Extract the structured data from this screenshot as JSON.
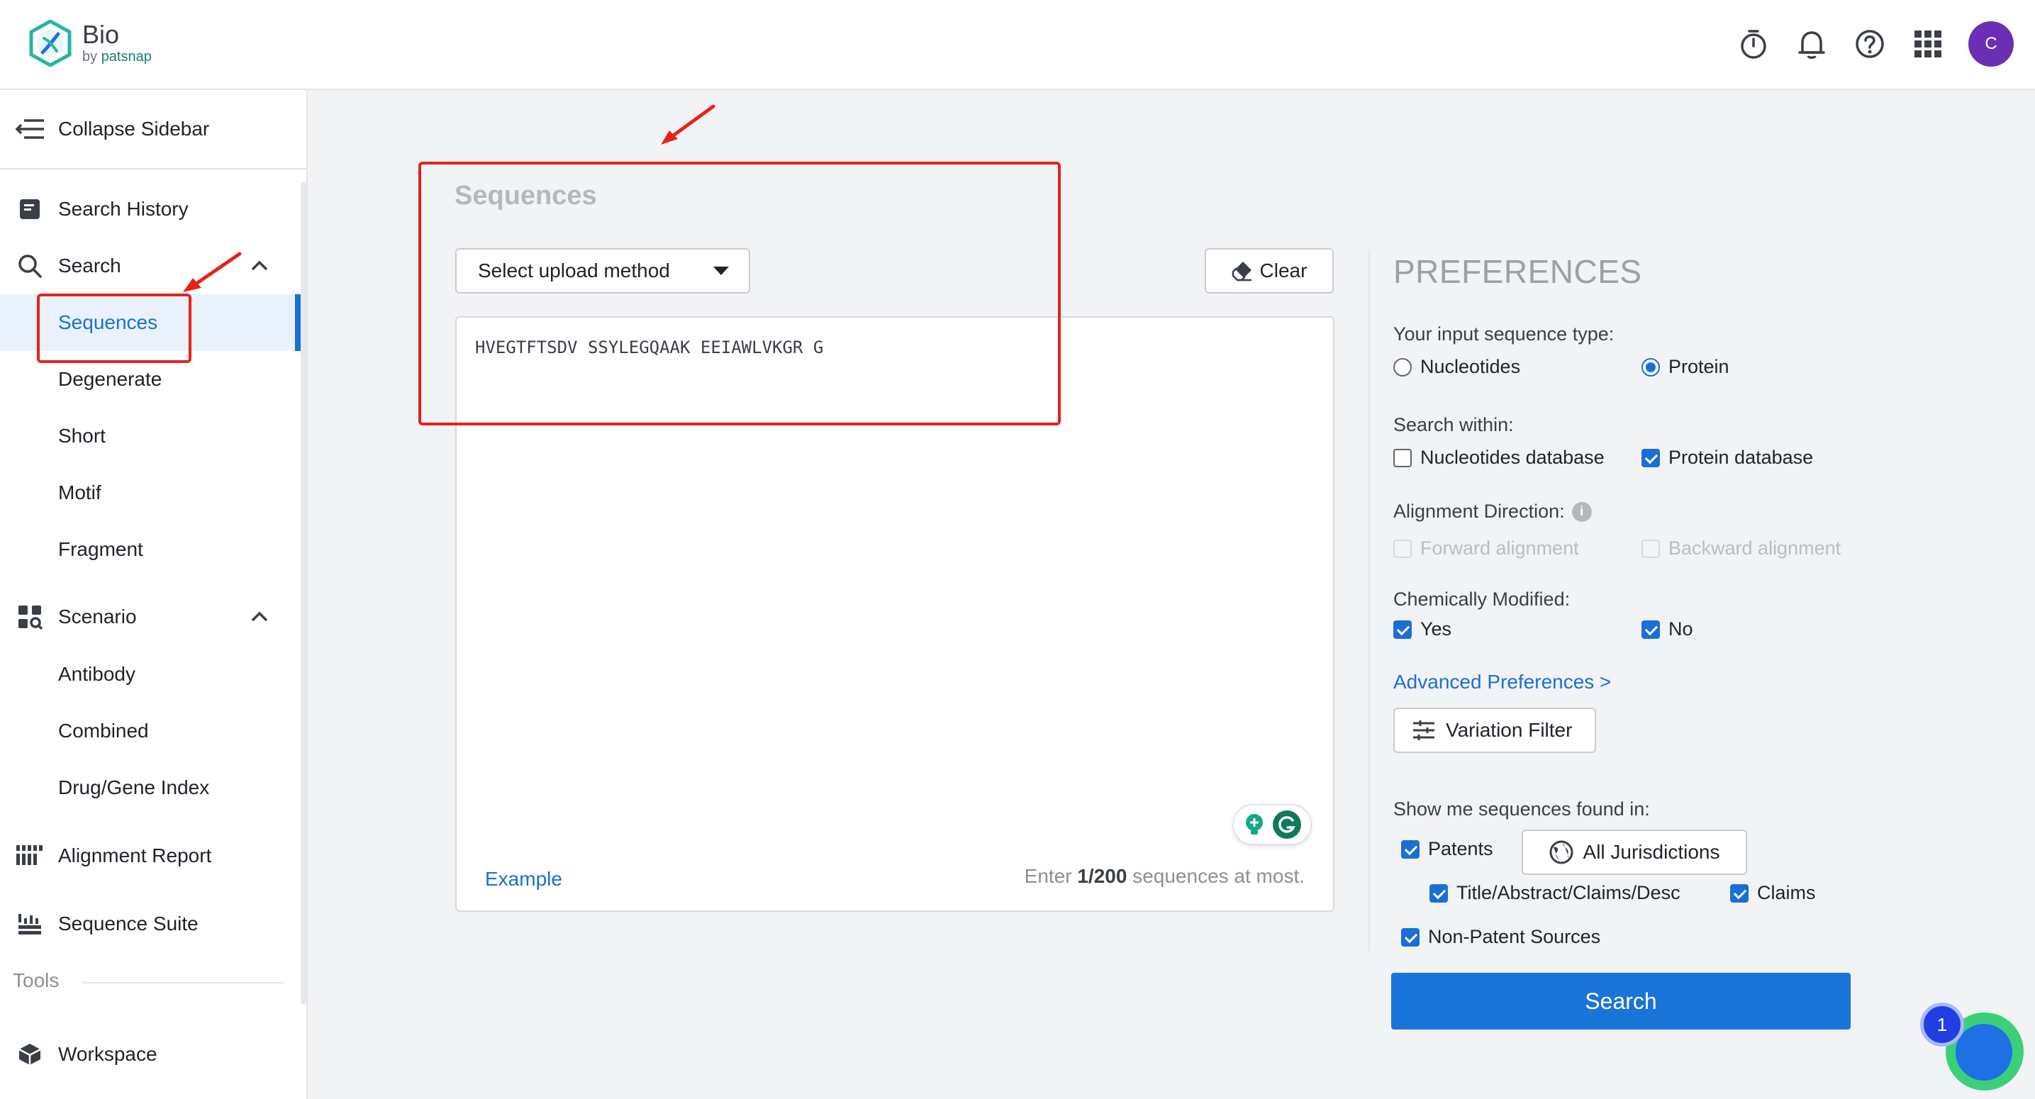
{
  "header": {
    "logo_title": "Bio",
    "logo_sub_by": "by",
    "logo_sub_brand": "patsnap",
    "avatar_initial": "C",
    "icons": [
      "timer-icon",
      "bell-icon",
      "help-icon",
      "apps-grid-icon"
    ]
  },
  "sidebar": {
    "collapse_label": "Collapse Sidebar",
    "search_history": "Search History",
    "search": "Search",
    "search_items": [
      "Sequences",
      "Degenerate",
      "Short",
      "Motif",
      "Fragment"
    ],
    "scenario": "Scenario",
    "scenario_items": [
      "Antibody",
      "Combined",
      "Drug/Gene Index"
    ],
    "alignment_report": "Alignment Report",
    "sequence_suite": "Sequence Suite",
    "tools_label": "Tools",
    "workspace": "Workspace"
  },
  "main": {
    "section_title": "Sequences",
    "upload_select_value": "Select upload method",
    "clear_label": "Clear",
    "sequence_value": "HVEGTFTSDV SSYLEGQAAK EEIAWLVKGR G",
    "example_label": "Example",
    "limit_prefix": "Enter ",
    "limit_count": "1/200",
    "limit_suffix": " sequences at most."
  },
  "preferences": {
    "title": "PREFERENCES",
    "input_type_label": "Your input sequence type:",
    "input_type_options": [
      "Nucleotides",
      "Protein"
    ],
    "input_type_selected": "Protein",
    "search_within_label": "Search within:",
    "search_within": [
      {
        "label": "Nucleotides database",
        "checked": false
      },
      {
        "label": "Protein database",
        "checked": true
      }
    ],
    "alignment_label": "Alignment Direction:",
    "alignment_info": "i",
    "alignment_options": [
      {
        "label": "Forward alignment",
        "disabled": true
      },
      {
        "label": "Backward alignment",
        "disabled": true
      }
    ],
    "chem_label": "Chemically Modified:",
    "chem_options": [
      {
        "label": "Yes",
        "checked": true
      },
      {
        "label": "No",
        "checked": true
      }
    ],
    "advanced_link": "Advanced Preferences >",
    "variation_filter": "Variation Filter",
    "show_label": "Show me sequences found in:",
    "patents": "Patents",
    "jurisdictions": "All Jurisdictions",
    "title_abstract": "Title/Abstract/Claims/Desc",
    "claims": "Claims",
    "non_patent": "Non-Patent Sources",
    "search_button": "Search"
  },
  "widget": {
    "badge_count": "1"
  },
  "colors": {
    "accent": "#1a6fd6",
    "annotation": "#e8221b",
    "avatar": "#6b2fb3"
  }
}
